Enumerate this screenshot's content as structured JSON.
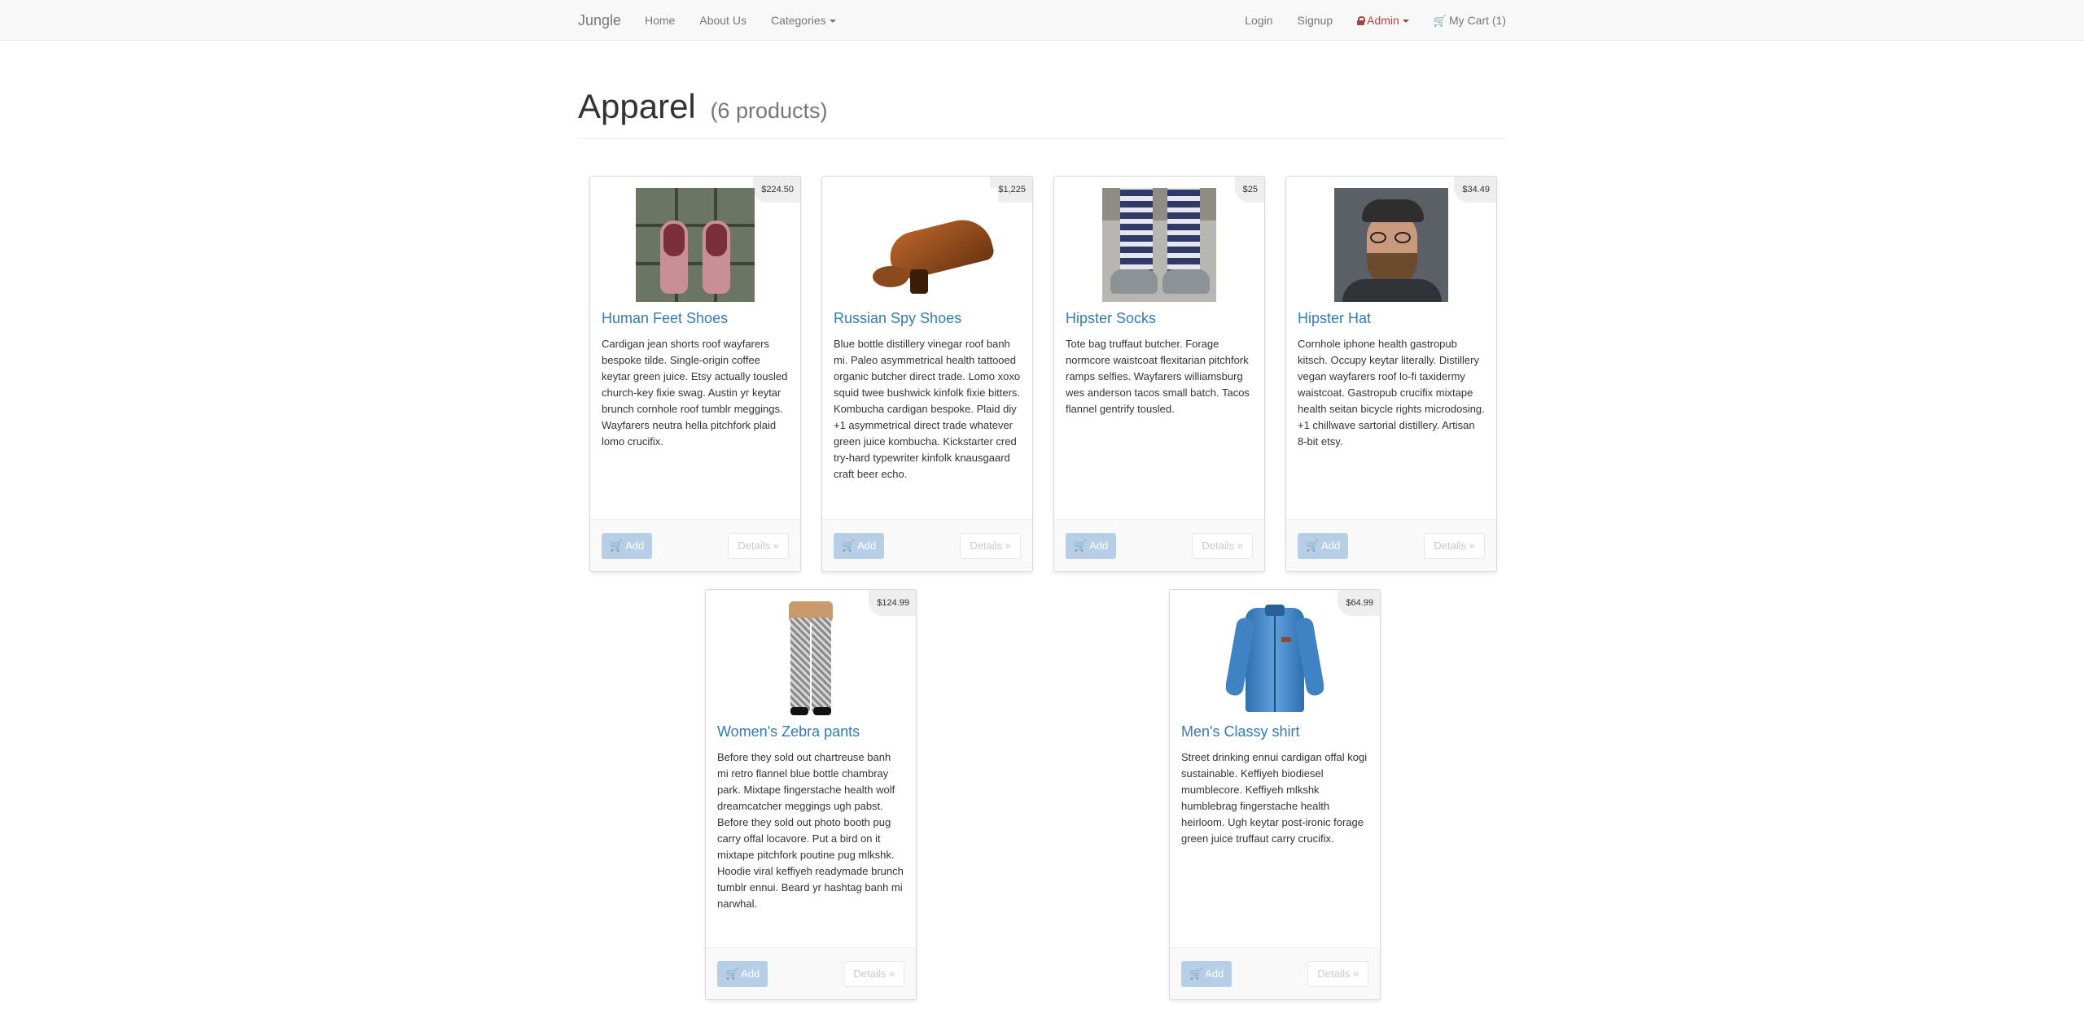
{
  "nav": {
    "brand": "Jungle",
    "home": "Home",
    "about": "About Us",
    "categories": "Categories",
    "login": "Login",
    "signup": "Signup",
    "admin": "Admin",
    "cart": "My Cart (1)"
  },
  "header": {
    "title": "Apparel",
    "count": "(6 products)"
  },
  "products": [
    {
      "name": "Human Feet Shoes",
      "price": "$224.50",
      "description": "Cardigan jean shorts roof wayfarers bespoke tilde. Single-origin coffee keytar green juice. Etsy actually tousled church-key fixie swag. Austin yr keytar brunch cornhole roof tumblr meggings. Wayfarers neutra hella pitchfork plaid lomo crucifix.",
      "add_label": "Add",
      "details_label": "Details »"
    },
    {
      "name": "Russian Spy Shoes",
      "price": "$1,225",
      "description": "Blue bottle distillery vinegar roof banh mi. Paleo asymmetrical health tattooed organic butcher direct trade. Lomo xoxo squid twee bushwick kinfolk fixie bitters. Kombucha cardigan bespoke. Plaid diy +1 asymmetrical direct trade whatever green juice kombucha. Kickstarter cred try-hard typewriter kinfolk knausgaard craft beer echo.",
      "add_label": "Add",
      "details_label": "Details »"
    },
    {
      "name": "Hipster Socks",
      "price": "$25",
      "description": "Tote bag truffaut butcher. Forage normcore waistcoat flexitarian pitchfork ramps selfies. Wayfarers williamsburg wes anderson tacos small batch. Tacos flannel gentrify tousled.",
      "add_label": "Add",
      "details_label": "Details »"
    },
    {
      "name": "Hipster Hat",
      "price": "$34.49",
      "description": "Cornhole iphone health gastropub kitsch. Occupy keytar literally. Distillery vegan wayfarers roof lo-fi taxidermy waistcoat. Gastropub crucifix mixtape health seitan bicycle rights microdosing. +1 chillwave sartorial distillery. Artisan 8-bit etsy.",
      "add_label": "Add",
      "details_label": "Details »"
    },
    {
      "name": "Women's Zebra pants",
      "price": "$124.99",
      "description": "Before they sold out chartreuse banh mi retro flannel blue bottle chambray park. Mixtape fingerstache health wolf dreamcatcher meggings ugh pabst. Before they sold out photo booth pug carry offal locavore. Put a bird on it mixtape pitchfork poutine pug mlkshk. Hoodie viral keffiyeh readymade brunch tumblr ennui. Beard yr hashtag banh mi narwhal.",
      "add_label": "Add",
      "details_label": "Details »"
    },
    {
      "name": "Men's Classy shirt",
      "price": "$64.99",
      "description": "Street drinking ennui cardigan offal kogi sustainable. Keffiyeh biodiesel mumblecore. Keffiyeh mlkshk humblebrag fingerstache health heirloom. Ugh keytar post-ironic forage green juice truffaut carry crucifix.",
      "add_label": "Add",
      "details_label": "Details »"
    }
  ]
}
